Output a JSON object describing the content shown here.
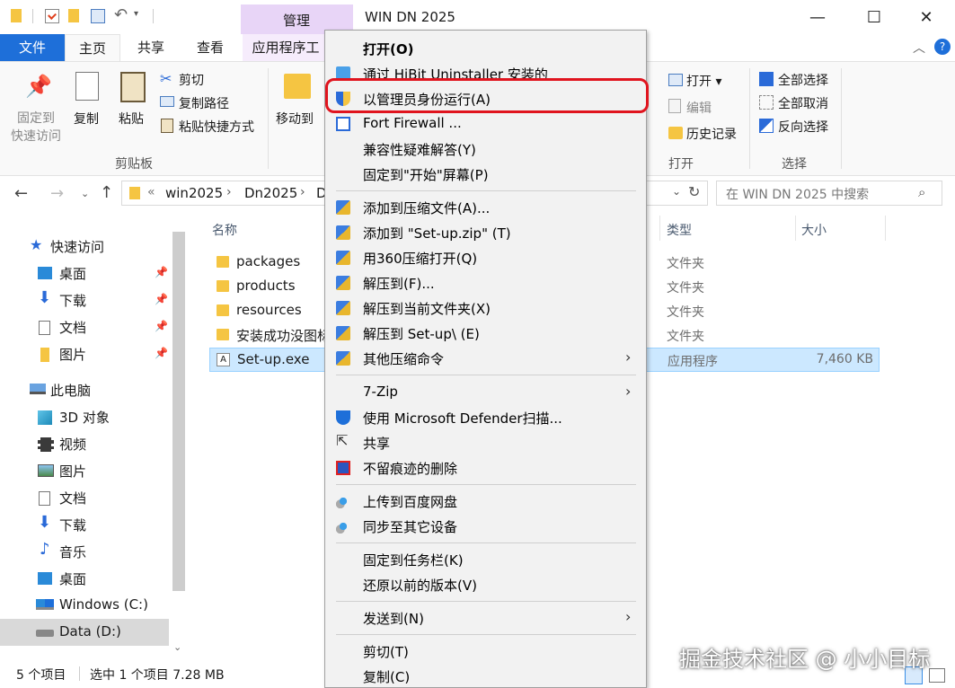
{
  "title_bar": {
    "manage_tab": "管理",
    "window_title": "WIN DN 2025",
    "minimize": "—",
    "maximize": "☐",
    "close": "✕"
  },
  "ribbon_tabs": [
    "文件",
    "主页",
    "共享",
    "查看",
    "应用程序工"
  ],
  "ribbon": {
    "pin_quick": [
      "固定到",
      "快速访问"
    ],
    "copy": "复制",
    "paste": "粘贴",
    "cut": "剪切",
    "copy_path": "复制路径",
    "paste_shortcut": "粘贴快捷方式",
    "clipboard_group": "剪贴板",
    "move_to": "移动到",
    "open_dropdown": "打开 ▾",
    "edit": "编辑",
    "history": "历史记录",
    "open_group": "打开",
    "select_all": "全部选择",
    "select_none": "全部取消",
    "invert_select": "反向选择",
    "select_group": "选择"
  },
  "address": {
    "crumbs": [
      "«",
      "win2025",
      "›",
      "Dn2025",
      "›",
      "D"
    ],
    "search_placeholder": "在 WIN DN 2025 中搜索"
  },
  "columns": {
    "name": "名称",
    "type": "类型",
    "size": "大小"
  },
  "nav": {
    "quick_access": "快速访问",
    "quick_items": [
      "桌面",
      "下载",
      "文档",
      "图片"
    ],
    "this_pc": "此电脑",
    "pc_items": [
      "3D 对象",
      "视频",
      "图片",
      "文档",
      "下载",
      "音乐",
      "桌面",
      "Windows (C:)",
      "Data (D:)"
    ]
  },
  "files": [
    {
      "name": "packages",
      "type": "文件夹",
      "size": ""
    },
    {
      "name": "products",
      "type": "文件夹",
      "size": ""
    },
    {
      "name": "resources",
      "type": "文件夹",
      "size": ""
    },
    {
      "name": "安装成功没图标",
      "type": "文件夹",
      "size": ""
    },
    {
      "name": "Set-up.exe",
      "type": "应用程序",
      "size": "7,460 KB"
    }
  ],
  "context_menu": [
    {
      "label": "打开(O)",
      "icon": "",
      "bold": true
    },
    {
      "label": "通过 HiBit Uninstaller 安装的",
      "icon": "hibit-icon"
    },
    {
      "label": "以管理员身份运行(A)",
      "icon": "uac-shield-icon",
      "highlighted": true
    },
    {
      "label": "Fort Firewall ...",
      "icon": "firewall-icon"
    },
    {
      "label": "兼容性疑难解答(Y)",
      "icon": ""
    },
    {
      "label": "固定到\"开始\"屏幕(P)",
      "icon": ""
    },
    {
      "label": "添加到压缩文件(A)...",
      "icon": "zip-icon"
    },
    {
      "label": "添加到 \"Set-up.zip\" (T)",
      "icon": "zip-icon"
    },
    {
      "label": "用360压缩打开(Q)",
      "icon": "zip-icon"
    },
    {
      "label": "解压到(F)...",
      "icon": "zip-icon"
    },
    {
      "label": "解压到当前文件夹(X)",
      "icon": "zip-icon"
    },
    {
      "label": "解压到 Set-up\\ (E)",
      "icon": "zip-icon"
    },
    {
      "label": "其他压缩命令",
      "icon": "zip-icon",
      "submenu": true
    },
    {
      "label": "7-Zip",
      "icon": "",
      "submenu": true
    },
    {
      "label": "使用 Microsoft Defender扫描...",
      "icon": "defender-icon"
    },
    {
      "label": "共享",
      "icon": "share-icon"
    },
    {
      "label": "不留痕迹的删除",
      "icon": "shred-icon"
    },
    {
      "label": "上传到百度网盘",
      "icon": "baidu-icon"
    },
    {
      "label": "同步至其它设备",
      "icon": "baidu-icon"
    },
    {
      "label": "固定到任务栏(K)",
      "icon": ""
    },
    {
      "label": "还原以前的版本(V)",
      "icon": ""
    },
    {
      "label": "发送到(N)",
      "icon": "",
      "submenu": true
    },
    {
      "label": "剪切(T)",
      "icon": ""
    },
    {
      "label": "复制(C)",
      "icon": ""
    }
  ],
  "status": {
    "count": "5 个项目",
    "selected": "选中 1 个项目  7.28 MB"
  },
  "watermark": "掘金技术社区 @ 小小目标",
  "colors": {
    "accent": "#1e6fd9",
    "manage_tab": "#e8d5f7",
    "highlight_ring": "#e0141e",
    "selected_row": "#cce8ff"
  }
}
